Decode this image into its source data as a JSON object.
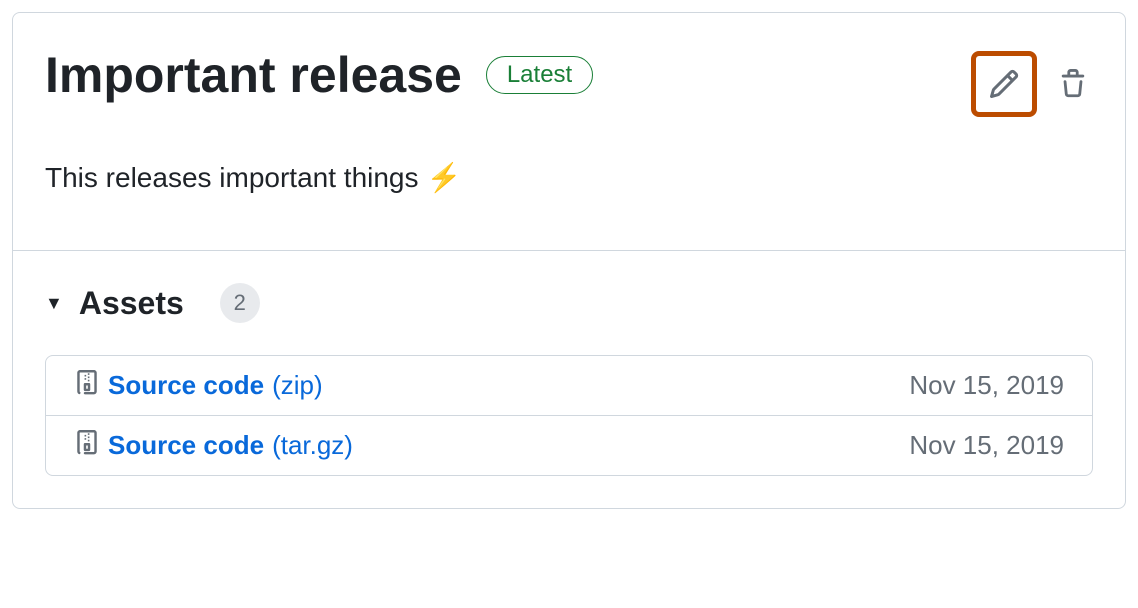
{
  "release": {
    "title": "Important release",
    "badge": "Latest",
    "description": "This releases important things",
    "emoji": "⚡"
  },
  "assets": {
    "heading": "Assets",
    "count": "2",
    "items": [
      {
        "name": "Source code",
        "ext": "(zip)",
        "date": "Nov 15, 2019"
      },
      {
        "name": "Source code",
        "ext": "(tar.gz)",
        "date": "Nov 15, 2019"
      }
    ]
  }
}
